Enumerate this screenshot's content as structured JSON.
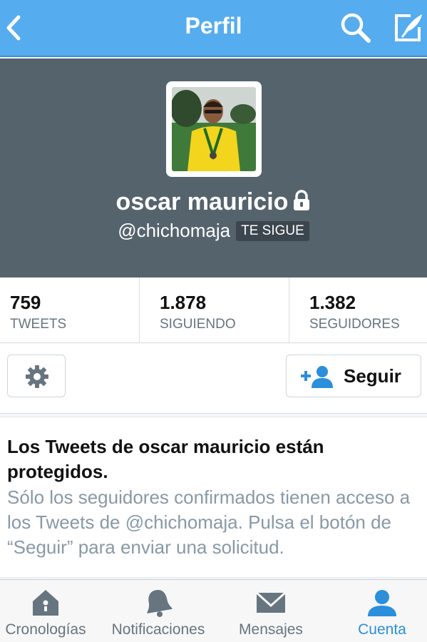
{
  "navbar": {
    "title": "Perfil",
    "icons": [
      "chevron-left-icon",
      "search-icon",
      "compose-icon"
    ],
    "bg_color": "#55acee"
  },
  "profile": {
    "name": "oscar mauricio",
    "handle": "@chichomaja",
    "follows_you_badge": "TE SIGUE",
    "header_color": "#55636d",
    "protected": true
  },
  "stats": [
    {
      "value": "759",
      "label": "TWEETS"
    },
    {
      "value": "1.878",
      "label": "SIGUIENDO"
    },
    {
      "value": "1.382",
      "label": "SEGUIDORES"
    }
  ],
  "actions": {
    "follow_label": "Seguir"
  },
  "protected_notice": {
    "title": "Los Tweets de oscar mauricio están protegidos.",
    "body": "Sólo los seguidores confirmados tienen acceso a los Tweets de @chichomaja. Pulsa el botón de “Seguir” para enviar una solicitud."
  },
  "tabbar": {
    "items": [
      {
        "label": "Cronologías",
        "icon": "home-icon",
        "active": false
      },
      {
        "label": "Notificaciones",
        "icon": "bell-icon",
        "active": false
      },
      {
        "label": "Mensajes",
        "icon": "envelope-icon",
        "active": false
      },
      {
        "label": "Cuenta",
        "icon": "user-icon",
        "active": true
      }
    ],
    "active_color": "#2b8fdb"
  }
}
